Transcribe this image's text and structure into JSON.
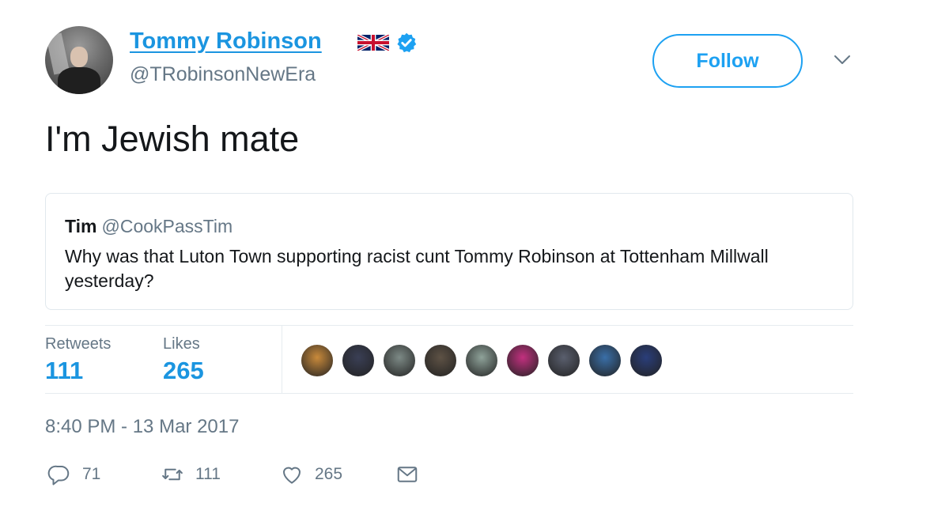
{
  "tweet": {
    "author": {
      "display_name": "Tommy Robinson",
      "handle": "@TRobinsonNewEra",
      "flag_icon": "uk-flag-icon",
      "verified_icon": "verified-badge-icon",
      "avatar_icon": "profile-avatar"
    },
    "follow_label": "Follow",
    "menu_icon": "chevron-down-icon",
    "text": "I'm Jewish mate",
    "quoted": {
      "name": "Tim",
      "handle": "@CookPassTim",
      "text": "Why was that Luton Town supporting racist cunt Tommy Robinson at Tottenham Millwall yesterday?"
    },
    "stats": {
      "retweets_label": "Retweets",
      "retweets_value": "111",
      "likes_label": "Likes",
      "likes_value": "265"
    },
    "likers": [
      {
        "name": "liker-avatar-1",
        "color": "#c98a3b"
      },
      {
        "name": "liker-avatar-2",
        "color": "#3a3f55"
      },
      {
        "name": "liker-avatar-3",
        "color": "#7d8a86"
      },
      {
        "name": "liker-avatar-4",
        "color": "#5e5245"
      },
      {
        "name": "liker-avatar-5",
        "color": "#8fa39a"
      },
      {
        "name": "liker-avatar-6",
        "color": "#c2307f"
      },
      {
        "name": "liker-avatar-7",
        "color": "#5a5f6e"
      },
      {
        "name": "liker-avatar-8",
        "color": "#3a6fa8"
      },
      {
        "name": "liker-avatar-9",
        "color": "#2a3e7a"
      }
    ],
    "timestamp": "8:40 PM - 13 Mar 2017",
    "actions": {
      "reply_icon": "reply-icon",
      "reply_count": "71",
      "retweet_icon": "retweet-icon",
      "retweet_count": "111",
      "like_icon": "heart-icon",
      "like_count": "265",
      "message_icon": "envelope-icon"
    },
    "colors": {
      "accent": "#1da1f2",
      "link": "#1b95e0",
      "secondary_text": "#657786",
      "border": "#e1e8ed"
    }
  }
}
